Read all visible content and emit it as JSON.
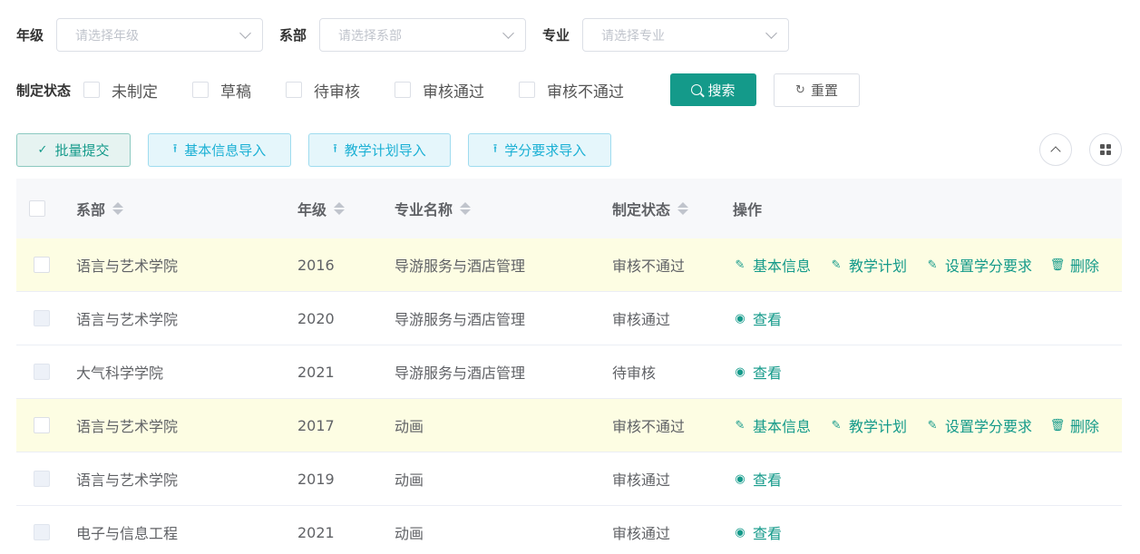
{
  "filters": {
    "grade_label": "年级",
    "grade_placeholder": "请选择年级",
    "dept_label": "系部",
    "dept_placeholder": "请选择系部",
    "major_label": "专业",
    "major_placeholder": "请选择专业",
    "status_label": "制定状态",
    "status_options": [
      "未制定",
      "草稿",
      "待审核",
      "审核通过",
      "审核不通过"
    ],
    "search_label": "搜索",
    "reset_label": "重置"
  },
  "toolbar": {
    "submit_label": "批量提交",
    "import_basic_label": "基本信息导入",
    "import_plan_label": "教学计划导入",
    "import_credit_label": "学分要求导入"
  },
  "table": {
    "columns": [
      "系部",
      "年级",
      "专业名称",
      "制定状态",
      "操作"
    ],
    "actions": {
      "basic": "基本信息",
      "plan": "教学计划",
      "credit": "设置学分要求",
      "delete": "删除",
      "view": "查看"
    },
    "rows": [
      {
        "dept": "语言与艺术学院",
        "grade": "2016",
        "major": "导游服务与酒店管理",
        "status": "审核不通过"
      },
      {
        "dept": "语言与艺术学院",
        "grade": "2020",
        "major": "导游服务与酒店管理",
        "status": "审核通过"
      },
      {
        "dept": "大气科学学院",
        "grade": "2021",
        "major": "导游服务与酒店管理",
        "status": "待审核"
      },
      {
        "dept": "语言与艺术学院",
        "grade": "2017",
        "major": "动画",
        "status": "审核不通过"
      },
      {
        "dept": "语言与艺术学院",
        "grade": "2019",
        "major": "动画",
        "status": "审核通过"
      },
      {
        "dept": "电子与信息工程",
        "grade": "2021",
        "major": "动画",
        "status": "审核通过"
      }
    ]
  },
  "colors": {
    "primary": "#149a8a",
    "info": "#1bb0d4",
    "highlight_row": "#fdfde3"
  }
}
